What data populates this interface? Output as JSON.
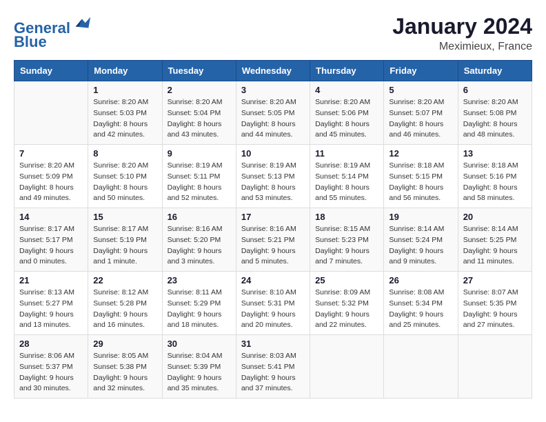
{
  "header": {
    "logo_line1": "General",
    "logo_line2": "Blue",
    "title": "January 2024",
    "subtitle": "Meximieux, France"
  },
  "columns": [
    "Sunday",
    "Monday",
    "Tuesday",
    "Wednesday",
    "Thursday",
    "Friday",
    "Saturday"
  ],
  "weeks": [
    [
      {
        "day": "",
        "info": ""
      },
      {
        "day": "1",
        "info": "Sunrise: 8:20 AM\nSunset: 5:03 PM\nDaylight: 8 hours\nand 42 minutes."
      },
      {
        "day": "2",
        "info": "Sunrise: 8:20 AM\nSunset: 5:04 PM\nDaylight: 8 hours\nand 43 minutes."
      },
      {
        "day": "3",
        "info": "Sunrise: 8:20 AM\nSunset: 5:05 PM\nDaylight: 8 hours\nand 44 minutes."
      },
      {
        "day": "4",
        "info": "Sunrise: 8:20 AM\nSunset: 5:06 PM\nDaylight: 8 hours\nand 45 minutes."
      },
      {
        "day": "5",
        "info": "Sunrise: 8:20 AM\nSunset: 5:07 PM\nDaylight: 8 hours\nand 46 minutes."
      },
      {
        "day": "6",
        "info": "Sunrise: 8:20 AM\nSunset: 5:08 PM\nDaylight: 8 hours\nand 48 minutes."
      }
    ],
    [
      {
        "day": "7",
        "info": "Sunrise: 8:20 AM\nSunset: 5:09 PM\nDaylight: 8 hours\nand 49 minutes."
      },
      {
        "day": "8",
        "info": "Sunrise: 8:20 AM\nSunset: 5:10 PM\nDaylight: 8 hours\nand 50 minutes."
      },
      {
        "day": "9",
        "info": "Sunrise: 8:19 AM\nSunset: 5:11 PM\nDaylight: 8 hours\nand 52 minutes."
      },
      {
        "day": "10",
        "info": "Sunrise: 8:19 AM\nSunset: 5:13 PM\nDaylight: 8 hours\nand 53 minutes."
      },
      {
        "day": "11",
        "info": "Sunrise: 8:19 AM\nSunset: 5:14 PM\nDaylight: 8 hours\nand 55 minutes."
      },
      {
        "day": "12",
        "info": "Sunrise: 8:18 AM\nSunset: 5:15 PM\nDaylight: 8 hours\nand 56 minutes."
      },
      {
        "day": "13",
        "info": "Sunrise: 8:18 AM\nSunset: 5:16 PM\nDaylight: 8 hours\nand 58 minutes."
      }
    ],
    [
      {
        "day": "14",
        "info": "Sunrise: 8:17 AM\nSunset: 5:17 PM\nDaylight: 9 hours\nand 0 minutes."
      },
      {
        "day": "15",
        "info": "Sunrise: 8:17 AM\nSunset: 5:19 PM\nDaylight: 9 hours\nand 1 minute."
      },
      {
        "day": "16",
        "info": "Sunrise: 8:16 AM\nSunset: 5:20 PM\nDaylight: 9 hours\nand 3 minutes."
      },
      {
        "day": "17",
        "info": "Sunrise: 8:16 AM\nSunset: 5:21 PM\nDaylight: 9 hours\nand 5 minutes."
      },
      {
        "day": "18",
        "info": "Sunrise: 8:15 AM\nSunset: 5:23 PM\nDaylight: 9 hours\nand 7 minutes."
      },
      {
        "day": "19",
        "info": "Sunrise: 8:14 AM\nSunset: 5:24 PM\nDaylight: 9 hours\nand 9 minutes."
      },
      {
        "day": "20",
        "info": "Sunrise: 8:14 AM\nSunset: 5:25 PM\nDaylight: 9 hours\nand 11 minutes."
      }
    ],
    [
      {
        "day": "21",
        "info": "Sunrise: 8:13 AM\nSunset: 5:27 PM\nDaylight: 9 hours\nand 13 minutes."
      },
      {
        "day": "22",
        "info": "Sunrise: 8:12 AM\nSunset: 5:28 PM\nDaylight: 9 hours\nand 16 minutes."
      },
      {
        "day": "23",
        "info": "Sunrise: 8:11 AM\nSunset: 5:29 PM\nDaylight: 9 hours\nand 18 minutes."
      },
      {
        "day": "24",
        "info": "Sunrise: 8:10 AM\nSunset: 5:31 PM\nDaylight: 9 hours\nand 20 minutes."
      },
      {
        "day": "25",
        "info": "Sunrise: 8:09 AM\nSunset: 5:32 PM\nDaylight: 9 hours\nand 22 minutes."
      },
      {
        "day": "26",
        "info": "Sunrise: 8:08 AM\nSunset: 5:34 PM\nDaylight: 9 hours\nand 25 minutes."
      },
      {
        "day": "27",
        "info": "Sunrise: 8:07 AM\nSunset: 5:35 PM\nDaylight: 9 hours\nand 27 minutes."
      }
    ],
    [
      {
        "day": "28",
        "info": "Sunrise: 8:06 AM\nSunset: 5:37 PM\nDaylight: 9 hours\nand 30 minutes."
      },
      {
        "day": "29",
        "info": "Sunrise: 8:05 AM\nSunset: 5:38 PM\nDaylight: 9 hours\nand 32 minutes."
      },
      {
        "day": "30",
        "info": "Sunrise: 8:04 AM\nSunset: 5:39 PM\nDaylight: 9 hours\nand 35 minutes."
      },
      {
        "day": "31",
        "info": "Sunrise: 8:03 AM\nSunset: 5:41 PM\nDaylight: 9 hours\nand 37 minutes."
      },
      {
        "day": "",
        "info": ""
      },
      {
        "day": "",
        "info": ""
      },
      {
        "day": "",
        "info": ""
      }
    ]
  ]
}
